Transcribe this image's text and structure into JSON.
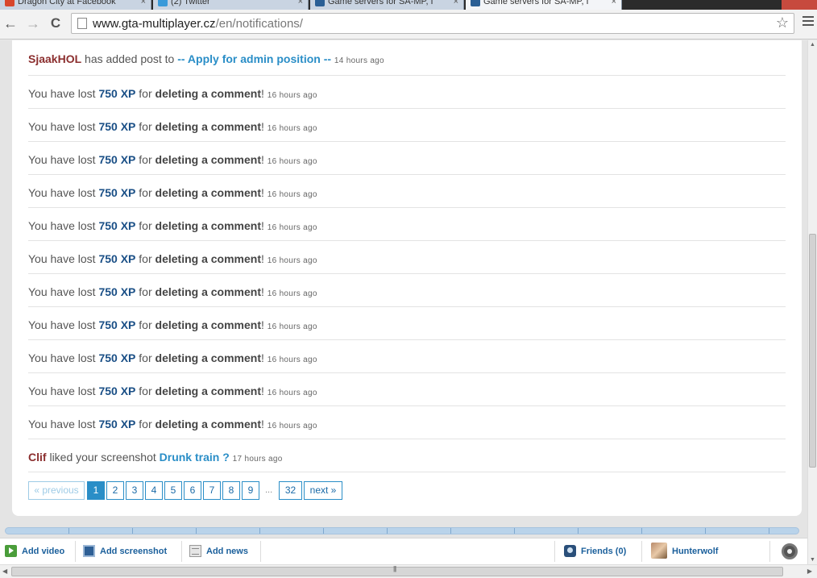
{
  "browser": {
    "tabs": [
      {
        "title": "Dragon City at Facebook",
        "icon_color": "#d8462c"
      },
      {
        "title": "(2) Twitter",
        "icon_color": "#3a9ad9"
      },
      {
        "title": "Game servers for SA-MP, I",
        "icon_color": "#2a5f95"
      },
      {
        "title": "Game servers for SA-MP, I",
        "icon_color": "#2a5f95"
      }
    ],
    "close_glyph": "×",
    "url_domain": "www.gta-multiplayer.cz",
    "url_path": "/en/notifications/",
    "back_glyph": "←",
    "forward_glyph": "→",
    "reload_glyph": "C",
    "star_glyph": "☆"
  },
  "notifications": [
    {
      "kind": "post",
      "user": "SjaakHOL",
      "text": " has added post to ",
      "link": "-- Apply for admin position --",
      "time": "14 hours ago"
    },
    {
      "kind": "xp",
      "prefix": "You have lost ",
      "xp": "750 XP",
      "mid": " for ",
      "action": "deleting a comment",
      "suffix": "!",
      "time": "16 hours ago"
    },
    {
      "kind": "xp",
      "prefix": "You have lost ",
      "xp": "750 XP",
      "mid": " for ",
      "action": "deleting a comment",
      "suffix": "!",
      "time": "16 hours ago"
    },
    {
      "kind": "xp",
      "prefix": "You have lost ",
      "xp": "750 XP",
      "mid": " for ",
      "action": "deleting a comment",
      "suffix": "!",
      "time": "16 hours ago"
    },
    {
      "kind": "xp",
      "prefix": "You have lost ",
      "xp": "750 XP",
      "mid": " for ",
      "action": "deleting a comment",
      "suffix": "!",
      "time": "16 hours ago"
    },
    {
      "kind": "xp",
      "prefix": "You have lost ",
      "xp": "750 XP",
      "mid": " for ",
      "action": "deleting a comment",
      "suffix": "!",
      "time": "16 hours ago"
    },
    {
      "kind": "xp",
      "prefix": "You have lost ",
      "xp": "750 XP",
      "mid": " for ",
      "action": "deleting a comment",
      "suffix": "!",
      "time": "16 hours ago"
    },
    {
      "kind": "xp",
      "prefix": "You have lost ",
      "xp": "750 XP",
      "mid": " for ",
      "action": "deleting a comment",
      "suffix": "!",
      "time": "16 hours ago"
    },
    {
      "kind": "xp",
      "prefix": "You have lost ",
      "xp": "750 XP",
      "mid": " for ",
      "action": "deleting a comment",
      "suffix": "!",
      "time": "16 hours ago"
    },
    {
      "kind": "xp",
      "prefix": "You have lost ",
      "xp": "750 XP",
      "mid": " for ",
      "action": "deleting a comment",
      "suffix": "!",
      "time": "16 hours ago"
    },
    {
      "kind": "xp",
      "prefix": "You have lost ",
      "xp": "750 XP",
      "mid": " for ",
      "action": "deleting a comment",
      "suffix": "!",
      "time": "16 hours ago"
    },
    {
      "kind": "xp",
      "prefix": "You have lost ",
      "xp": "750 XP",
      "mid": " for ",
      "action": "deleting a comment",
      "suffix": "!",
      "time": "16 hours ago"
    },
    {
      "kind": "post",
      "user": "Clif",
      "text": " liked your screenshot ",
      "link": "Drunk train ?",
      "time": "17 hours ago"
    }
  ],
  "pagination": {
    "previous": "« previous",
    "pages": [
      "1",
      "2",
      "3",
      "4",
      "5",
      "6",
      "7",
      "8",
      "9"
    ],
    "current": "1",
    "ellipsis": "...",
    "last": "32",
    "next": "next »"
  },
  "bottombar": {
    "add_video": "Add video",
    "add_screenshot": "Add screenshot",
    "add_news": "Add news",
    "friends": "Friends (0)",
    "username": "Hunterwolf"
  },
  "colors": {
    "user": "#8b2e2e",
    "link": "#2a8ec7",
    "xp": "#1a4f86"
  }
}
